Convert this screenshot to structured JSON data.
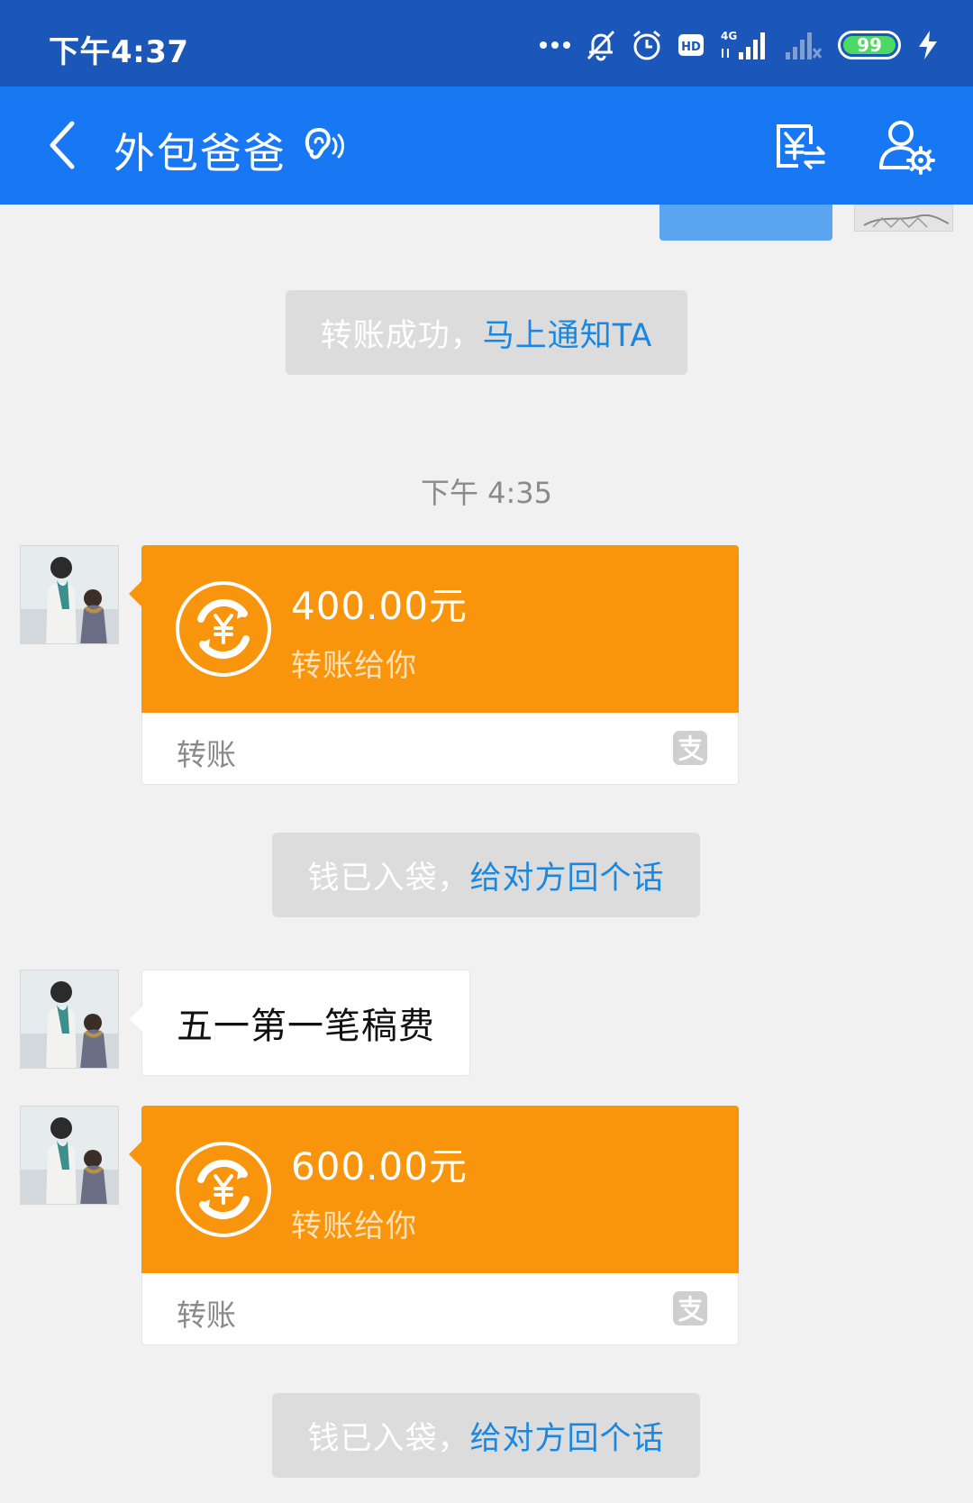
{
  "status_bar": {
    "time": "下午4:37",
    "network": "4G",
    "hd": "HD",
    "battery": "99",
    "icons": [
      "more-dots-icon",
      "bell-muted-icon",
      "alarm-icon",
      "hd-icon",
      "signal-4g-icon",
      "signal-empty-icon",
      "battery-icon",
      "charging-icon"
    ]
  },
  "header": {
    "title": "外包爸爸",
    "icons": [
      "back-arrow-icon",
      "ear-icon",
      "transfer-yuan-icon",
      "person-settings-icon"
    ]
  },
  "chat": {
    "notice_top": {
      "text": "转账成功，",
      "link": "马上通知TA"
    },
    "timestamp": "下午 4:35",
    "transfers": [
      {
        "amount": "400.00元",
        "subtitle": "转账给你",
        "label": "转账"
      },
      {
        "amount": "600.00元",
        "subtitle": "转账给你",
        "label": "转账"
      }
    ],
    "notices_received": [
      {
        "text": "钱已入袋，",
        "link": "给对方回个话"
      },
      {
        "text": "钱已入袋，",
        "link": "给对方回个话"
      }
    ],
    "message": "五一第一笔稿费"
  },
  "colors": {
    "status_bar": "#1a57b8",
    "header": "#1878f3",
    "background": "#f1f1f1",
    "transfer_orange": "#f8950c",
    "link_blue": "#1a87e0"
  }
}
